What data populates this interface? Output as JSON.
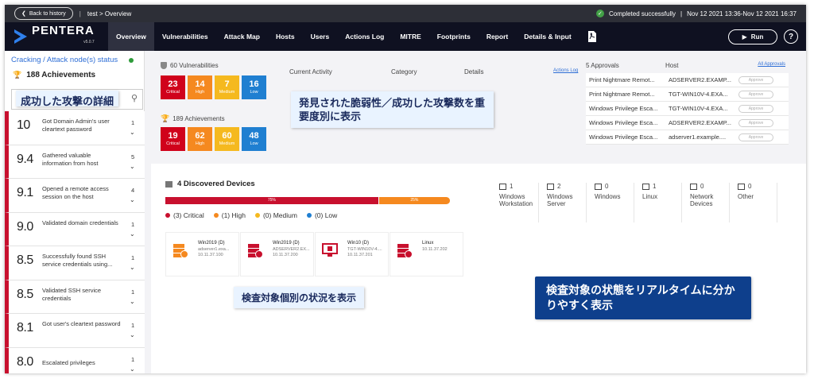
{
  "topbar": {
    "back_label": "Back to history",
    "breadcrumb": "test > Overview",
    "status": "Completed successfully",
    "range": "Nov 12 2021 13:36-Nov 12 2021 16:37"
  },
  "nav": {
    "logo": "PENTERA",
    "version": "v5.0.7",
    "items": [
      "Overview",
      "Vulnerabilities",
      "Attack Map",
      "Hosts",
      "Users",
      "Actions Log",
      "MITRE",
      "Footprints",
      "Report",
      "Details & Input"
    ],
    "run_label": "Run",
    "help_label": "?"
  },
  "sidebar": {
    "title": "Cracking / Attack node(s) status",
    "achievements": "188 Achievements",
    "callout": "成功した攻撃の詳細",
    "items": [
      {
        "score": "10",
        "desc": "Got Domain Admin's user cleartext password",
        "count": "1"
      },
      {
        "score": "9.4",
        "desc": "Gathered valuable information from host",
        "count": "5"
      },
      {
        "score": "9.1",
        "desc": "Opened a remote access session on the host",
        "count": "4"
      },
      {
        "score": "9.0",
        "desc": "Validated domain credentials",
        "count": "1"
      },
      {
        "score": "8.5",
        "desc": "Successfully found SSH service credentials using...",
        "count": "1"
      },
      {
        "score": "8.5",
        "desc": "Validated SSH service credentials",
        "count": "1"
      },
      {
        "score": "8.1",
        "desc": "Got user's cleartext password",
        "count": "1"
      },
      {
        "score": "8.0",
        "desc": "Escalated privileges",
        "count": "1"
      }
    ]
  },
  "summary": {
    "vuln_title": "60 Vulnerabilities",
    "vuln_badges": [
      {
        "n": "23",
        "l": "Critical"
      },
      {
        "n": "14",
        "l": "High"
      },
      {
        "n": "7",
        "l": "Medium"
      },
      {
        "n": "16",
        "l": "Low"
      }
    ],
    "ach_title": "189 Achievements",
    "ach_badges": [
      {
        "n": "19",
        "l": "Critical"
      },
      {
        "n": "62",
        "l": "High"
      },
      {
        "n": "60",
        "l": "Medium"
      },
      {
        "n": "48",
        "l": "Low"
      }
    ],
    "current_activity": "Current Activity",
    "category": "Category",
    "details": "Details",
    "actions_log_link": "Actions Log",
    "callout": "発見された脆弱性／成功した攻撃数を重要度別に表示"
  },
  "approvals": {
    "title": "5 Approvals",
    "host_header": "Host",
    "all_link": "All Approvals",
    "button_label": "Approve",
    "rows": [
      {
        "name": "Print Nightmare Remot...",
        "host": "ADSERVER2.EXAMP..."
      },
      {
        "name": "Print Nightmare Remot...",
        "host": "TGT-WIN10V-4.EXA..."
      },
      {
        "name": "Windows Privilege Esca...",
        "host": "TGT-WIN10V-4.EXA..."
      },
      {
        "name": "Windows Privilege Esca...",
        "host": "ADSERVER2.EXAMP..."
      },
      {
        "name": "Windows Privilege Esca...",
        "host": "adserver1.example...."
      }
    ]
  },
  "devices": {
    "title": "4 Discovered Devices",
    "bar": {
      "critical_pct": "75%",
      "high_pct": "25%",
      "critical_frac": 0.75,
      "high_frac": 0.25
    },
    "legend": [
      "(3) Critical",
      "(1) High",
      "(0) Medium",
      "(0) Low"
    ],
    "types": [
      {
        "count": "1",
        "label": "Windows Workstation"
      },
      {
        "count": "2",
        "label": "Windows Server"
      },
      {
        "count": "0",
        "label": "Windows"
      },
      {
        "count": "1",
        "label": "Linux"
      },
      {
        "count": "0",
        "label": "Network Devices"
      },
      {
        "count": "0",
        "label": "Other"
      }
    ],
    "hosts": [
      {
        "name": "Win2019 (D)",
        "sub": "adserver1.exa...",
        "ip": "10.11.37.100"
      },
      {
        "name": "Win2019 (D)",
        "sub": "ADSERVER2.EX...",
        "ip": "10.11.37.200"
      },
      {
        "name": "Win10 (D)",
        "sub": "TGT-WIN10V-4....",
        "ip": "10.11.37.201"
      },
      {
        "name": "Linux",
        "sub": "",
        "ip": "10.11.37.202"
      }
    ],
    "callout_hosts": "検査対象個別の状況を表示",
    "callout_realtime": "検査対象の状態をリアルタイムに分かりやすく表示"
  },
  "colors": {
    "critical": "#d0021b",
    "high": "#f5891f",
    "medium": "#f5b91f",
    "low": "#1f7fd1",
    "nav_bg": "#0f1121"
  }
}
